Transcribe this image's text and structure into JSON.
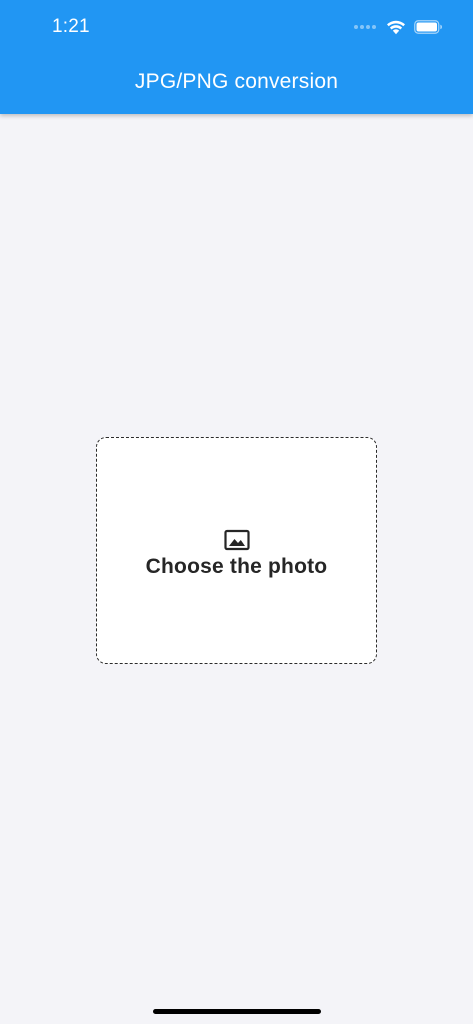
{
  "status_bar": {
    "time": "1:21",
    "icons": [
      "cellular-signal-icon",
      "wifi-icon",
      "battery-icon"
    ]
  },
  "appbar": {
    "title": "JPG/PNG conversion"
  },
  "photo_picker": {
    "icon": "image-icon",
    "label": "Choose the photo"
  },
  "colors": {
    "primary": "#2196f3",
    "background": "#f4f4f8",
    "card": "#ffffff",
    "text": "#262626"
  }
}
